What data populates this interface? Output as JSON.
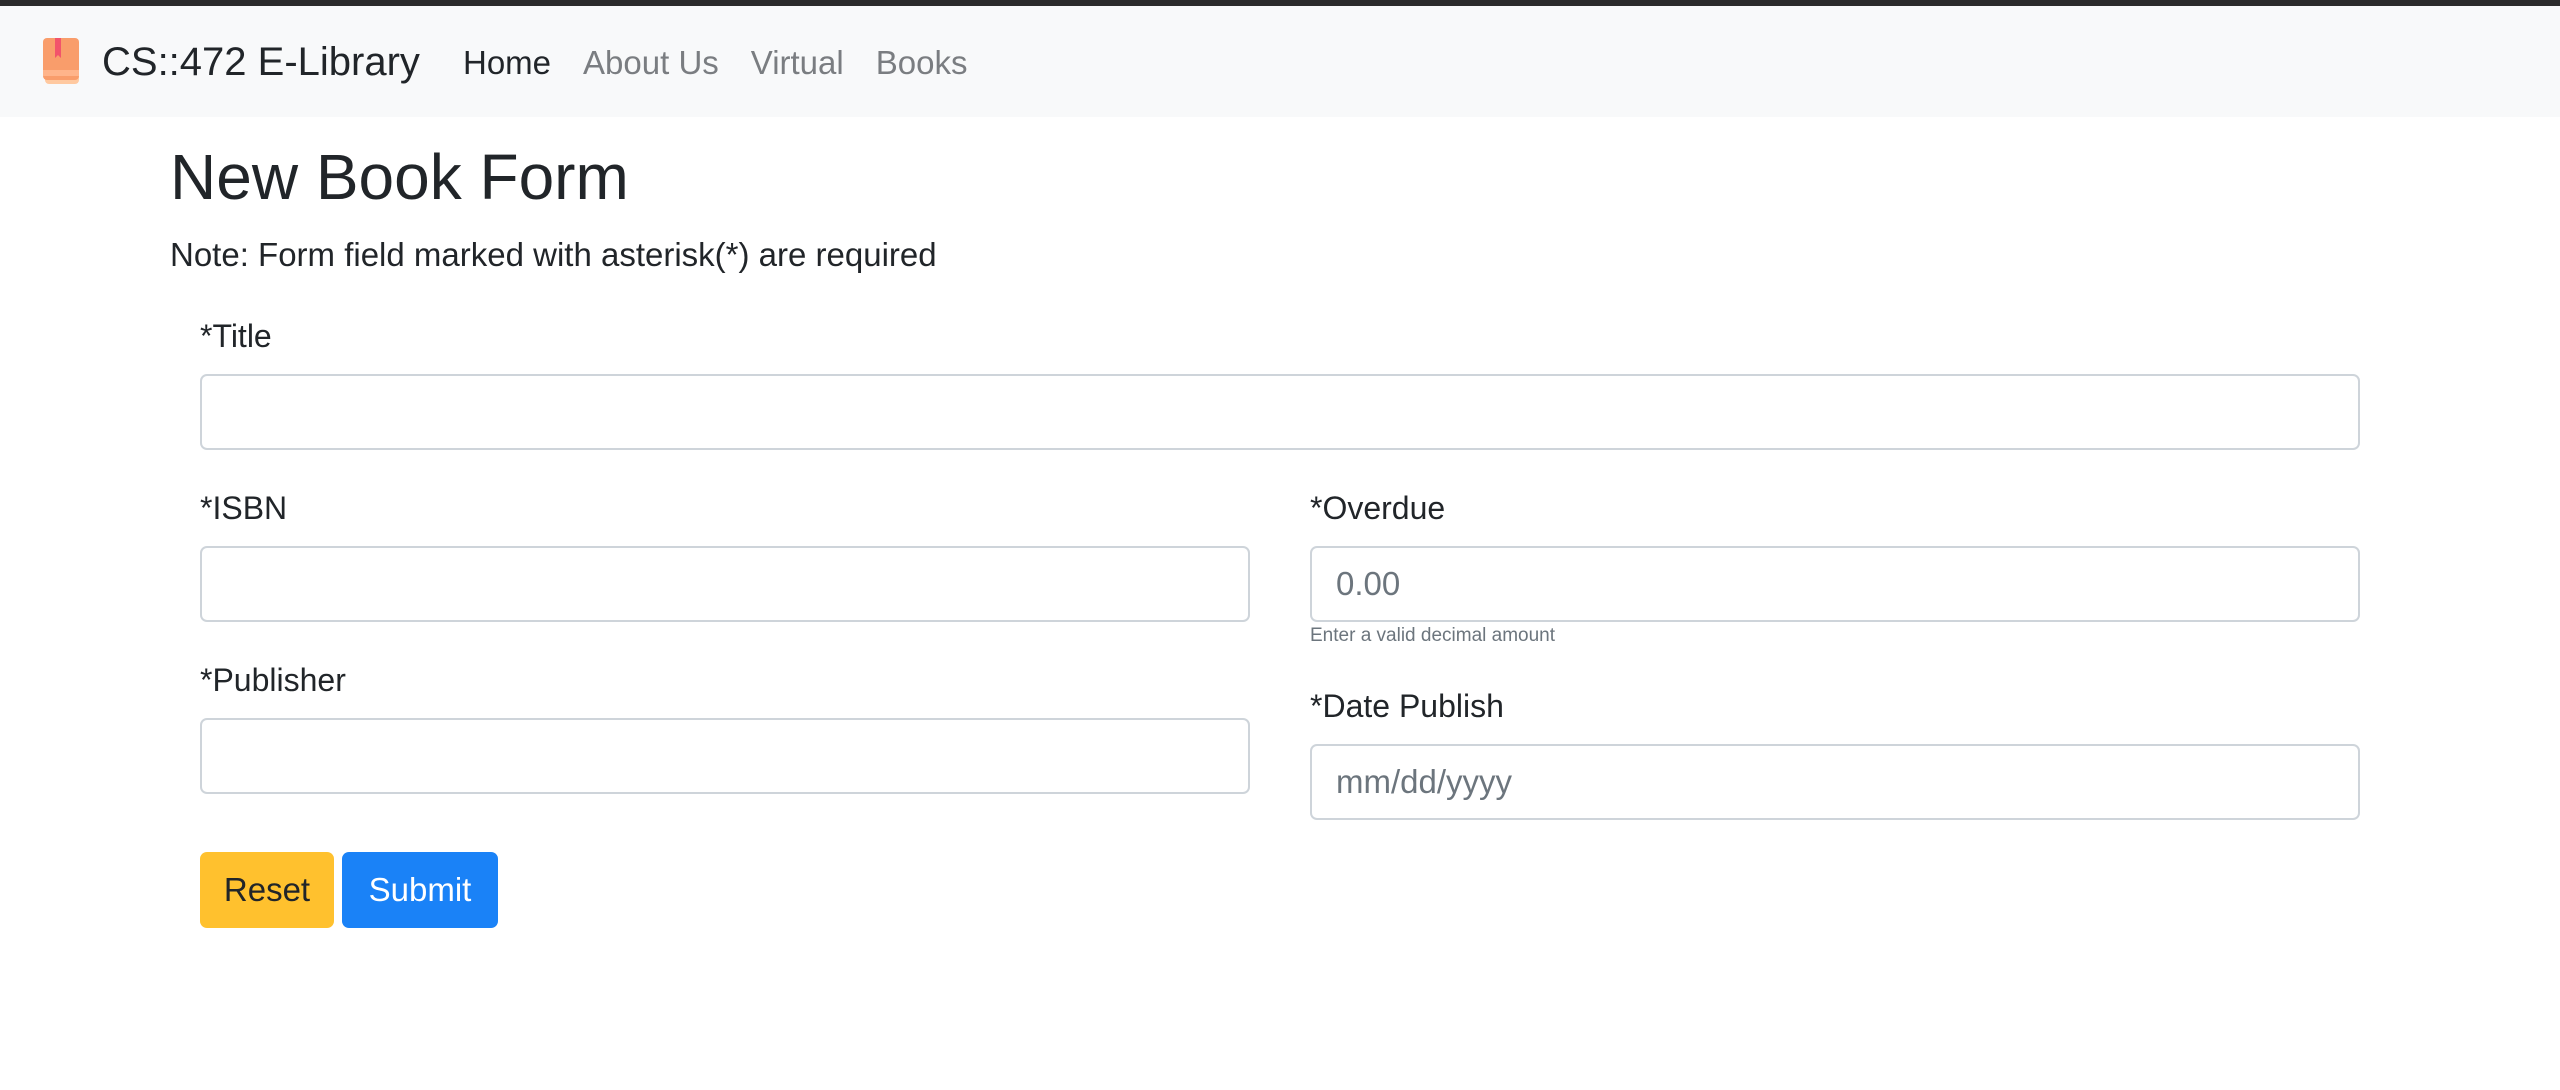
{
  "navbar": {
    "brand": "CS::472 E-Library",
    "logo_icon": "book-icon",
    "links": [
      {
        "label": "Home",
        "active": true
      },
      {
        "label": "About Us",
        "active": false
      },
      {
        "label": "Virtual",
        "active": false
      },
      {
        "label": "Books",
        "active": false
      }
    ]
  },
  "form": {
    "title": "New Book Form",
    "note": "Note: Form field marked with asterisk(*) are required",
    "fields": {
      "title": {
        "label": "*Title",
        "value": "",
        "placeholder": ""
      },
      "isbn": {
        "label": "*ISBN",
        "value": "",
        "placeholder": ""
      },
      "overdue": {
        "label": "*Overdue",
        "value": "",
        "placeholder": "0.00",
        "help": "Enter a valid decimal amount"
      },
      "publisher": {
        "label": "*Publisher",
        "value": "",
        "placeholder": ""
      },
      "date_publish": {
        "label": "*Date Publish",
        "value": "",
        "placeholder": "mm/dd/yyyy"
      }
    },
    "buttons": {
      "reset": "Reset",
      "submit": "Submit"
    }
  },
  "colors": {
    "navbar_bg": "#f8f9fa",
    "reset_button": "#ffc12e",
    "submit_button": "#1a82f7",
    "input_border": "#ced4da"
  }
}
